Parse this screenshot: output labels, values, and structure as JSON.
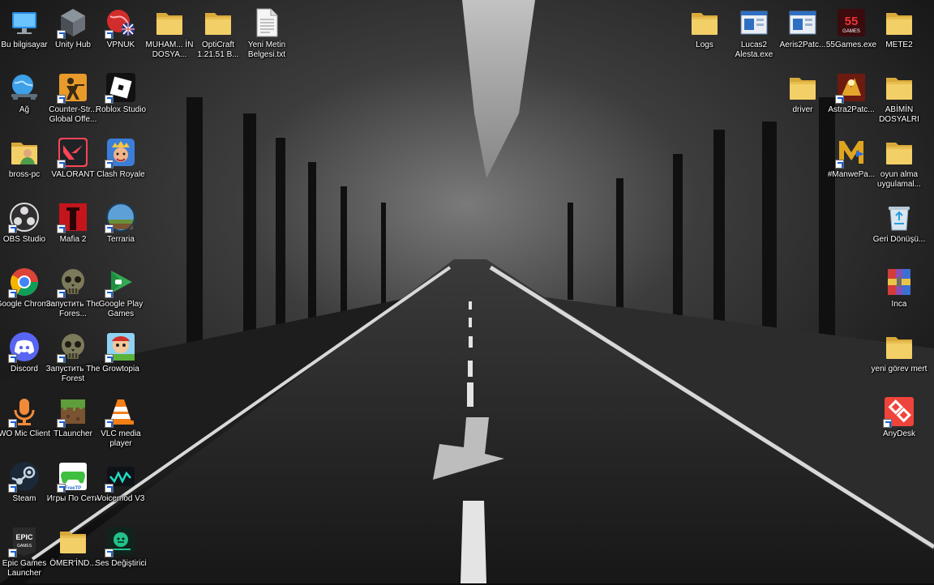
{
  "desktop": {
    "left_columns": [
      [
        {
          "name": "bu-bilgisayar",
          "label": "Bu bilgisayar",
          "icon": "computer-icon",
          "shortcut": false
        },
        {
          "name": "ag",
          "label": "Ağ",
          "icon": "network-icon",
          "shortcut": false
        },
        {
          "name": "bross-pc",
          "label": "bross-pc",
          "icon": "user-folder-icon",
          "shortcut": false
        },
        {
          "name": "obs-studio",
          "label": "OBS Studio",
          "icon": "obs-icon",
          "shortcut": true
        },
        {
          "name": "google-chrome",
          "label": "Google Chrome",
          "icon": "chrome-icon",
          "shortcut": true
        },
        {
          "name": "discord",
          "label": "Discord",
          "icon": "discord-icon",
          "shortcut": true
        },
        {
          "name": "wo-mic-client",
          "label": "WO Mic Client",
          "icon": "microphone-icon",
          "shortcut": true
        },
        {
          "name": "steam",
          "label": "Steam",
          "icon": "steam-icon",
          "shortcut": true
        },
        {
          "name": "epic-games-launcher",
          "label": "Epic Games Launcher",
          "icon": "epic-games-icon",
          "shortcut": true
        }
      ],
      [
        {
          "name": "unity-hub",
          "label": "Unity Hub",
          "icon": "unity-icon",
          "shortcut": true
        },
        {
          "name": "counter-strike",
          "label": "Counter-Str... Global Offe...",
          "icon": "counter-strike-icon",
          "shortcut": true
        },
        {
          "name": "valorant",
          "label": "VALORANT",
          "icon": "valorant-icon",
          "shortcut": true
        },
        {
          "name": "mafia-2",
          "label": "Mafia 2",
          "icon": "mafia-icon",
          "shortcut": true
        },
        {
          "name": "the-forest-launch-1",
          "label": "Запустить The Fores...",
          "icon": "skull-icon",
          "shortcut": true
        },
        {
          "name": "the-forest-launch-2",
          "label": "Запустить The Forest",
          "icon": "skull-icon",
          "shortcut": true
        },
        {
          "name": "tlauncher",
          "label": "TLauncher",
          "icon": "minecraft-block-icon",
          "shortcut": true
        },
        {
          "name": "igry-po-seti",
          "label": "Игры По Сети",
          "icon": "gamepad-icon",
          "shortcut": true
        },
        {
          "name": "omer-ind",
          "label": "ÖMER'İND...",
          "icon": "folder-icon",
          "shortcut": false
        }
      ],
      [
        {
          "name": "vpnuk",
          "label": "VPNUK",
          "icon": "vpn-globe-icon",
          "shortcut": true
        },
        {
          "name": "roblox-studio",
          "label": "Roblox Studio",
          "icon": "roblox-icon",
          "shortcut": true
        },
        {
          "name": "clash-royale",
          "label": "Clash Royale",
          "icon": "clash-royale-icon",
          "shortcut": true
        },
        {
          "name": "terraria",
          "label": "Terraria",
          "icon": "terraria-icon",
          "shortcut": true
        },
        {
          "name": "google-play-games",
          "label": "Google Play Games",
          "icon": "play-games-icon",
          "shortcut": true
        },
        {
          "name": "growtopia",
          "label": "Growtopia",
          "icon": "growtopia-icon",
          "shortcut": true
        },
        {
          "name": "vlc-media-player",
          "label": "VLC media player",
          "icon": "vlc-cone-icon",
          "shortcut": true
        },
        {
          "name": "voicemod-v3",
          "label": "Voicemod V3",
          "icon": "voicemod-icon",
          "shortcut": true
        },
        {
          "name": "ses-degistirici",
          "label": "Ses Değiştirici",
          "icon": "voice-changer-icon",
          "shortcut": true
        }
      ]
    ],
    "top_row_extra": [
      {
        "name": "muham-in-dosya",
        "label": "MUHAM... İN DOSYA...",
        "icon": "folder-icon",
        "shortcut": false
      },
      {
        "name": "opticraft",
        "label": "OptiCraft 1.21.51 B...",
        "icon": "folder-icon",
        "shortcut": false
      },
      {
        "name": "yeni-metin-belgesi",
        "label": "Yeni Metin Belgesi.txt",
        "icon": "text-file-icon",
        "shortcut": false
      }
    ],
    "right_area": [
      {
        "name": "logs",
        "label": "Logs",
        "icon": "folder-icon",
        "shortcut": false
      },
      {
        "name": "lucas2-alesta",
        "label": "Lucas2 Alesta.exe",
        "icon": "app-window-icon",
        "shortcut": false
      },
      {
        "name": "aeris2patch",
        "label": "Aeris2Patc...",
        "icon": "app-window-icon",
        "shortcut": false
      },
      {
        "name": "55games",
        "label": "55Games.exe",
        "icon": "55games-icon",
        "shortcut": false
      },
      {
        "name": "mete2",
        "label": "METE2",
        "icon": "folder-icon",
        "shortcut": false
      },
      {
        "name": "driver",
        "label": "driver",
        "icon": "folder-icon",
        "shortcut": false
      },
      {
        "name": "astra2patch",
        "label": "Astra2Patc...",
        "icon": "astra-icon",
        "shortcut": true
      },
      {
        "name": "abimin-dosyalri",
        "label": "ABİMİN DOSYALRI",
        "icon": "folder-icon",
        "shortcut": false
      },
      {
        "name": "manwepa",
        "label": "#ManwePa...",
        "icon": "manwe-icon",
        "shortcut": true
      },
      {
        "name": "oyun-alma",
        "label": "oyun alma uygulamal...",
        "icon": "folder-icon",
        "shortcut": false
      },
      {
        "name": "geri-donusum",
        "label": "Geri Dönüşü...",
        "icon": "recycle-bin-icon",
        "shortcut": false
      },
      {
        "name": "inca",
        "label": "Inca",
        "icon": "winrar-icon",
        "shortcut": false
      },
      {
        "name": "yeni-gorev-mert",
        "label": "yeni görev mert",
        "icon": "folder-icon",
        "shortcut": false
      },
      {
        "name": "anydesk",
        "label": "AnyDesk",
        "icon": "anydesk-icon",
        "shortcut": true
      }
    ]
  }
}
